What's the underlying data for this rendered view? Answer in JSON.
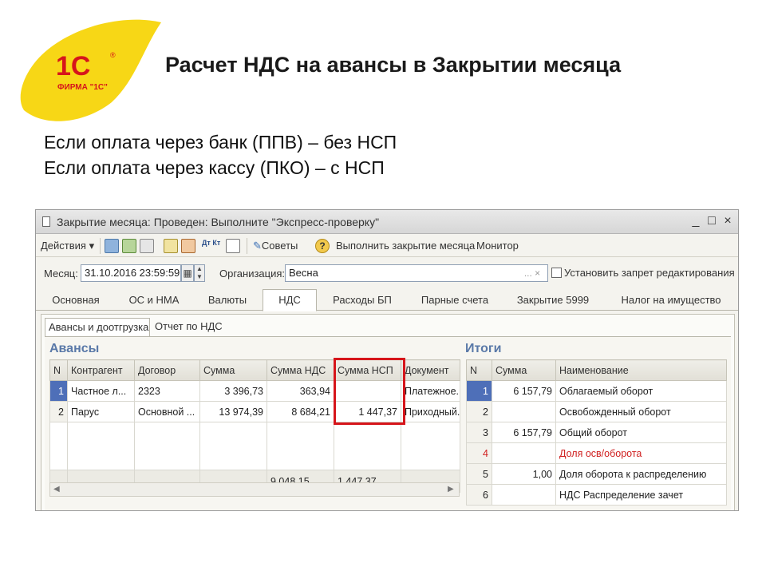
{
  "slide": {
    "logo_mark": "1С",
    "logo_caption": "ФИРМА \"1С\"",
    "title": "Расчет НДС на авансы в Закрытии месяца",
    "line1": "Если оплата через банк (ППВ) – без НСП",
    "line2": "Если оплата через кассу (ПКО) – с НСП"
  },
  "window": {
    "title": "Закрытие месяца: Проведен: Выполните \"Экспресс-проверку\"",
    "controls": {
      "minimize": "_",
      "maximize": "□",
      "close": "×"
    }
  },
  "toolbar": {
    "actions": "Действия",
    "advice": "Советы",
    "run_close": "Выполнить закрытие месяца",
    "monitor": "Монитор",
    "dt_kt": "Дт Кт"
  },
  "form": {
    "month_label": "Месяц:",
    "month_value": "31.10.2016 23:59:59",
    "org_label": "Организация:",
    "org_value": "Весна",
    "org_buttons": "... ×",
    "lock_label": "Установить запрет редактирования"
  },
  "tabs": [
    "Основная",
    "ОС и НМА",
    "Валюты",
    "НДС",
    "Расходы БП",
    "Парные счета",
    "Закрытие 5999",
    "Налог на имущество"
  ],
  "active_tab": "НДС",
  "subtabs": [
    "Авансы и доотгрузка",
    "Отчет по НДС"
  ],
  "avansy": {
    "title": "Авансы",
    "columns": [
      "N",
      "Контрагент",
      "Договор",
      "Сумма",
      "Сумма НДС",
      "Сумма НСП",
      "Документ"
    ],
    "rows": [
      [
        "1",
        "Частное л...",
        "2323",
        "3 396,73",
        "363,94",
        "",
        "Платежное..."
      ],
      [
        "2",
        "Парус",
        "Основной ...",
        "13 974,39",
        "8 684,21",
        "1 447,37",
        "Приходный..."
      ]
    ],
    "totals": [
      "",
      "",
      "",
      "",
      "9 048,15",
      "1 447,37",
      ""
    ]
  },
  "itogi": {
    "title": "Итоги",
    "columns": [
      "N",
      "Сумма",
      "Наименование"
    ],
    "rows": [
      [
        "1",
        "6 157,79",
        "Облагаемый оборот"
      ],
      [
        "2",
        "",
        "Освобожденный оборот"
      ],
      [
        "3",
        "6 157,79",
        "Общий оборот"
      ],
      [
        "4",
        "",
        "Доля осв/оборота"
      ],
      [
        "5",
        "1,00",
        "Доля оборота к распределению"
      ],
      [
        "6",
        "",
        "НДС Распределение зачет"
      ]
    ]
  },
  "colors": {
    "logo_yellow": "#f7d716",
    "logo_red": "#d6151b",
    "section_blue": "#5a79a8",
    "highlight_red": "#d6151b",
    "selected_row": "#4e6fb8"
  }
}
